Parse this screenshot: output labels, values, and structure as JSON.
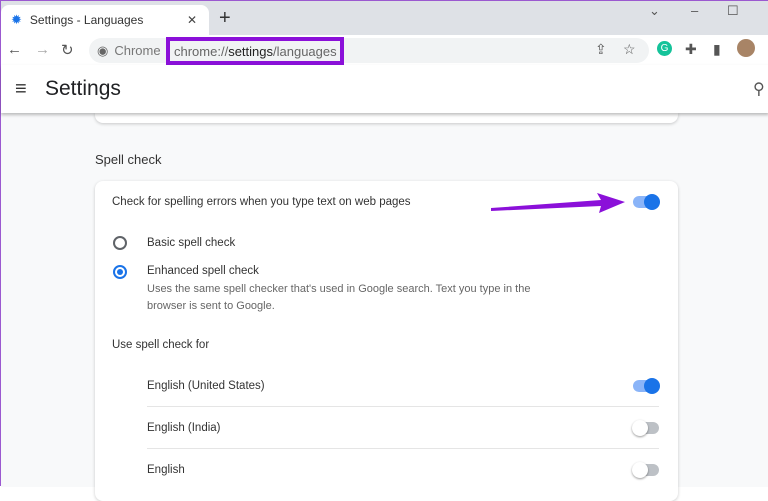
{
  "browser": {
    "tab_title": "Settings - Languages",
    "omnibox_label": "Chrome",
    "url_prefix": "chrome://",
    "url_path": "settings",
    "url_suffix": "/languages"
  },
  "header": {
    "title": "Settings"
  },
  "spell_check": {
    "section_title": "Spell check",
    "main_toggle_label": "Check for spelling errors when you type text on web pages",
    "main_toggle_on": true,
    "options": [
      {
        "label": "Basic spell check",
        "selected": false
      },
      {
        "label": "Enhanced spell check",
        "selected": true,
        "description": "Uses the same spell checker that's used in Google search. Text you type in the browser is sent to Google."
      }
    ],
    "use_for_label": "Use spell check for",
    "languages": [
      {
        "label": "English (United States)",
        "on": true
      },
      {
        "label": "English (India)",
        "on": false
      },
      {
        "label": "English",
        "on": false
      }
    ]
  },
  "colors": {
    "accent": "#1a73e8",
    "annotation": "#8b10d9"
  }
}
